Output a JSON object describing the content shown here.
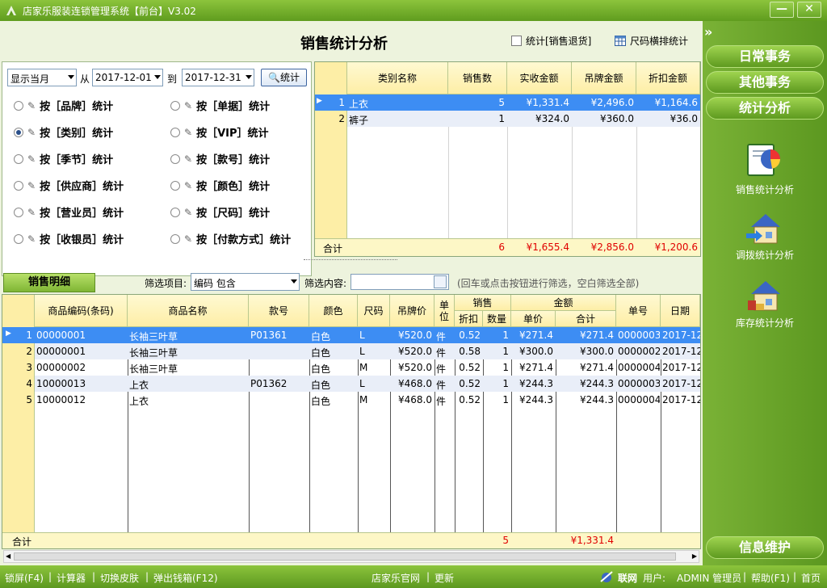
{
  "window": {
    "title": "店家乐服装连锁管理系统【前台】V3.02",
    "minimize_label": "—",
    "close_label": "✕"
  },
  "header": {
    "title": "销售统计分析",
    "return_check_label": "统计[销售退货]",
    "size_check_label": "尺码横排统计"
  },
  "filter": {
    "period_value": "显示当月",
    "from_label": "从",
    "date_from": "2017-12-01",
    "to_label": "到",
    "date_to": "2017-12-31",
    "stat_button_label": "统计",
    "options": [
      {
        "label": "按［品牌］统计",
        "selected": false
      },
      {
        "label": "按［单据］统计",
        "selected": false
      },
      {
        "label": "按［类别］统计",
        "selected": true
      },
      {
        "label": "按［VIP］统计",
        "selected": false
      },
      {
        "label": "按［季节］统计",
        "selected": false
      },
      {
        "label": "按［款号］统计",
        "selected": false
      },
      {
        "label": "按［供应商］统计",
        "selected": false
      },
      {
        "label": "按［颜色］统计",
        "selected": false
      },
      {
        "label": "按［营业员］统计",
        "selected": false
      },
      {
        "label": "按［尺码］统计",
        "selected": false
      },
      {
        "label": "按［收银员］统计",
        "selected": false
      },
      {
        "label": "按［付款方式］统计",
        "selected": false
      }
    ]
  },
  "summary": {
    "headers": [
      "类别名称",
      "销售数",
      "实收金额",
      "吊牌金额",
      "折扣金额"
    ],
    "rows": [
      {
        "no": "1",
        "category": "上衣",
        "qty": "5",
        "paid": "¥1,331.4",
        "tag": "¥2,496.0",
        "discount": "¥1,164.6"
      },
      {
        "no": "2",
        "category": "裤子",
        "qty": "1",
        "paid": "¥324.0",
        "tag": "¥360.0",
        "discount": "¥36.0"
      }
    ],
    "footer": {
      "label": "合计",
      "qty": "6",
      "paid": "¥1,655.4",
      "tag": "¥2,856.0",
      "discount": "¥1,200.6"
    }
  },
  "detail": {
    "tab_label": "销售明细",
    "filter_field_label": "筛选项目:",
    "filter_field_value": "编码 包含",
    "filter_content_label": "筛选内容:",
    "filter_hint": "(回车或点击按钮进行筛选，空白筛选全部)",
    "headers": {
      "code": "商品编码(条码)",
      "name": "商品名称",
      "style": "款号",
      "color": "颜色",
      "size": "尺码",
      "tag_price": "吊牌价",
      "unit": "单位",
      "sales_group": "销售",
      "discount": "折扣",
      "qty": "数量",
      "amount_group": "金额",
      "unit_price": "单价",
      "total": "合计",
      "bill_no": "单号",
      "date": "日期"
    },
    "rows": [
      {
        "no": "1",
        "code": "00000001",
        "name": "长袖三叶草",
        "style": "P01361",
        "color": "白色",
        "size": "L",
        "tag_price": "¥520.0",
        "unit": "件",
        "discount": "0.52",
        "qty": "1",
        "unit_price": "¥271.4",
        "total": "¥271.4",
        "bill_no": "0000003",
        "date": "2017-12-"
      },
      {
        "no": "2",
        "code": "00000001",
        "name": "长袖三叶草",
        "style": "",
        "color": "白色",
        "size": "L",
        "tag_price": "¥520.0",
        "unit": "件",
        "discount": "0.58",
        "qty": "1",
        "unit_price": "¥300.0",
        "total": "¥300.0",
        "bill_no": "0000002",
        "date": "2017-12-"
      },
      {
        "no": "3",
        "code": "00000002",
        "name": "长袖三叶草",
        "style": "",
        "color": "白色",
        "size": "M",
        "tag_price": "¥520.0",
        "unit": "件",
        "discount": "0.52",
        "qty": "1",
        "unit_price": "¥271.4",
        "total": "¥271.4",
        "bill_no": "0000004",
        "date": "2017-12-"
      },
      {
        "no": "4",
        "code": "10000013",
        "name": "上衣",
        "style": "P01362",
        "color": "白色",
        "size": "L",
        "tag_price": "¥468.0",
        "unit": "件",
        "discount": "0.52",
        "qty": "1",
        "unit_price": "¥244.3",
        "total": "¥244.3",
        "bill_no": "0000003",
        "date": "2017-12-"
      },
      {
        "no": "5",
        "code": "10000012",
        "name": "上衣",
        "style": "",
        "color": "白色",
        "size": "M",
        "tag_price": "¥468.0",
        "unit": "件",
        "discount": "0.52",
        "qty": "1",
        "unit_price": "¥244.3",
        "total": "¥244.3",
        "bill_no": "0000004",
        "date": "2017-12-"
      }
    ],
    "footer": {
      "label": "合计",
      "qty": "5",
      "total": "¥1,331.4"
    }
  },
  "sidebar": {
    "collapse_label": "»",
    "menu": [
      "日常事务",
      "其他事务",
      "统计分析"
    ],
    "tools": [
      "销售统计分析",
      "调拨统计分析",
      "库存统计分析"
    ],
    "bottom_button": "信息维护"
  },
  "statusbar": {
    "left_items": [
      "锁屏(F4)",
      "计算器",
      "切换皮肤",
      "弹出钱箱(F12)"
    ],
    "website": "店家乐官网",
    "update": "更新",
    "online": "联网",
    "user_label": "用户:",
    "user_name": "ADMIN 管理员",
    "help": "帮助(F1)",
    "home": "首页",
    "separator": "|"
  },
  "colors": {
    "accent_green": "#6aa828",
    "selection_blue": "#3d8df3",
    "header_yellow": "#fdeea6",
    "total_red": "#e00000"
  }
}
